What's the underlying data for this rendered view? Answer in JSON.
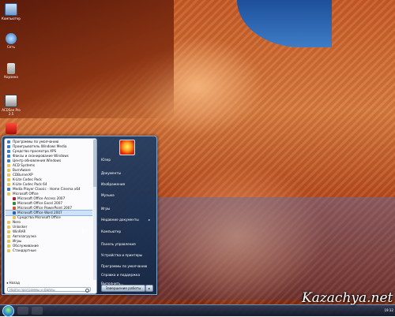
{
  "desktop": {
    "icons": [
      {
        "label": "Компьютер",
        "icon": "computer-icon"
      },
      {
        "label": "Сеть",
        "icon": "network-icon"
      },
      {
        "label": "Корзина",
        "icon": "recycle-bin-icon"
      },
      {
        "label": "ACDSee Pro 2.5",
        "icon": "acdsee-icon"
      },
      {
        "label": "",
        "icon": "pdf-icon"
      }
    ]
  },
  "start_menu": {
    "programs": [
      {
        "label": "Программы по умолчанию",
        "icon": "app",
        "sub": false
      },
      {
        "label": "Проигрыватель Windows Media",
        "icon": "app",
        "sub": false
      },
      {
        "label": "Средство просмотра XPS",
        "icon": "app",
        "sub": false
      },
      {
        "label": "Факсы и сканирование Windows",
        "icon": "app",
        "sub": false
      },
      {
        "label": "Центр обновления Windows",
        "icon": "app",
        "sub": false
      },
      {
        "label": "ACD Systems",
        "icon": "folder",
        "sub": false
      },
      {
        "label": "BurnAware",
        "icon": "folder",
        "sub": false
      },
      {
        "label": "CDBurnerXP",
        "icon": "folder",
        "sub": false
      },
      {
        "label": "K-Lite Codec Pack",
        "icon": "folder",
        "sub": false
      },
      {
        "label": "K-Lite Codec Pack 64",
        "icon": "folder",
        "sub": false
      },
      {
        "label": "Media Player Classic - Home Cinema x64",
        "icon": "app",
        "sub": false
      },
      {
        "label": "Microsoft Office",
        "icon": "folder",
        "sub": false
      },
      {
        "label": "Microsoft Office Access 2007",
        "icon": "access",
        "sub": true
      },
      {
        "label": "Microsoft Office Excel 2007",
        "icon": "excel",
        "sub": true
      },
      {
        "label": "Microsoft Office PowerPoint 2007",
        "icon": "ppt",
        "sub": true
      },
      {
        "label": "Microsoft Office Word 2007",
        "icon": "word",
        "sub": true,
        "selected": true
      },
      {
        "label": "Средства Microsoft Office",
        "icon": "folder",
        "sub": true
      },
      {
        "label": "Nero",
        "icon": "folder",
        "sub": false
      },
      {
        "label": "Unlocker",
        "icon": "folder",
        "sub": false
      },
      {
        "label": "WinRAR",
        "icon": "folder",
        "sub": false
      },
      {
        "label": "Автозагрузка",
        "icon": "folder",
        "sub": false
      },
      {
        "label": "Игры",
        "icon": "folder",
        "sub": false
      },
      {
        "label": "Обслуживание",
        "icon": "folder",
        "sub": false
      },
      {
        "label": "Стандартные",
        "icon": "folder",
        "sub": false
      }
    ],
    "back_label": "Назад",
    "search_placeholder": "Найти программы и файлы",
    "right_items": [
      {
        "label": "Юзер",
        "arrow": false
      },
      {
        "label": "Документы",
        "arrow": false
      },
      {
        "label": "Изображения",
        "arrow": false
      },
      {
        "label": "Музыка",
        "arrow": false
      },
      {
        "label": "Игры",
        "arrow": false
      },
      {
        "label": "Недавние документы",
        "arrow": true
      },
      {
        "label": "Компьютер",
        "arrow": false
      },
      {
        "label": "Панель управления",
        "arrow": false
      },
      {
        "label": "Устройства и принтеры",
        "arrow": false
      },
      {
        "label": "Программы по умолчанию",
        "arrow": false
      },
      {
        "label": "Справка и поддержка",
        "arrow": false
      },
      {
        "label": "Выполнить...",
        "arrow": false
      }
    ],
    "shutdown_label": "Завершение работы",
    "shutdown_arrow": "▸"
  },
  "taskbar": {
    "clock": "19:32"
  },
  "watermark": "Kazachya.net"
}
